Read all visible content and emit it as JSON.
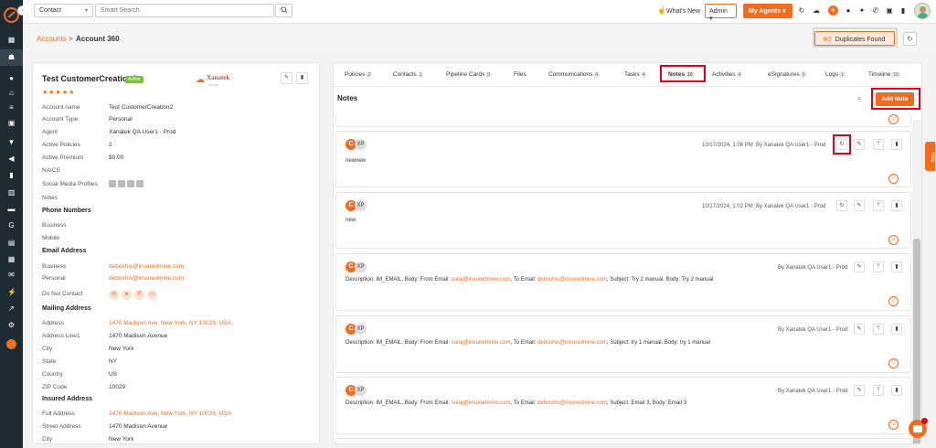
{
  "topbar": {
    "search_type": "Contact",
    "search_placeholder": "Smart Search",
    "whats_new": "What's New",
    "role": "Admin",
    "my_agents": "My Agents"
  },
  "breadcrumb": {
    "parent": "Accounts",
    "separator": ">",
    "current": "Account 360"
  },
  "duplicates": {
    "count": "2",
    "label": "Duplicates Found"
  },
  "account": {
    "name": "Test CustomerCreation2",
    "status": "Active",
    "stars": "★★★★★",
    "logo_name": "Xanatek",
    "logo_sub": "Group",
    "fields": [
      {
        "label": "Account name",
        "value": "Test CustomerCreation2"
      },
      {
        "label": "Account Type",
        "value": "Personal"
      },
      {
        "label": "Agent",
        "value": "Xanatek QA User1 - Prod"
      },
      {
        "label": "Active Policies",
        "value": "2"
      },
      {
        "label": "Active Premium",
        "value": "$0.00"
      },
      {
        "label": "NAICS",
        "value": ""
      },
      {
        "label": "Social Media Profiles",
        "value": ""
      },
      {
        "label": "Notes",
        "value": ""
      }
    ],
    "phone": {
      "title": "Phone Numbers",
      "business_label": "Business",
      "mobile_label": "Mobile"
    },
    "email": {
      "title": "Email Address",
      "business_label": "Business",
      "business_value": "deboshis@insuredmine.com",
      "personal_label": "Personal",
      "personal_value": "deboshis@insuredmine.com",
      "dnc_label": "Do Not Contact"
    },
    "mailing": {
      "title": "Mailing Address",
      "fields": [
        {
          "label": "Address",
          "value": "1470 Madison Ave, New York, NY 10029, USA"
        },
        {
          "label": "Address Line1",
          "value": "1470 Madison Avenue"
        },
        {
          "label": "City",
          "value": "New York"
        },
        {
          "label": "State",
          "value": "NY"
        },
        {
          "label": "Country",
          "value": "US"
        },
        {
          "label": "ZIP Code",
          "value": "10029"
        }
      ]
    },
    "insured": {
      "title": "Insured Address",
      "fields": [
        {
          "label": "Full Address",
          "value": "1470 Madison Ave, New York, NY 10029, USA"
        },
        {
          "label": "Street Address",
          "value": "1470 Madison Avenue"
        },
        {
          "label": "City",
          "value": "New York"
        }
      ]
    }
  },
  "tabs": [
    {
      "label": "Policies",
      "count": "2"
    },
    {
      "label": "Contacts",
      "count": "1"
    },
    {
      "label": "Pipeline Cards",
      "count": "0"
    },
    {
      "label": "Files",
      "count": ""
    },
    {
      "label": "Communications",
      "count": "4"
    },
    {
      "label": "Tasks",
      "count": "4"
    },
    {
      "label": "Notes",
      "count": "10"
    },
    {
      "label": "Activities",
      "count": "4"
    },
    {
      "label": "eSignatures",
      "count": "0"
    },
    {
      "label": "Logs",
      "count": "1"
    },
    {
      "label": "Timeline",
      "count": "10"
    }
  ],
  "notes_panel": {
    "title": "Notes",
    "add_label": "Add Note",
    "initials": "XP",
    "notes": [
      {
        "date": "10/17/2024, 1:06 PM",
        "author": "By Xanatek QA User1 - Prod",
        "text": "newnew",
        "email": null
      },
      {
        "date": "10/17/2024, 1:02 PM",
        "author": "By Xanatek QA User1 - Prod",
        "text": "new",
        "email": null
      },
      {
        "date": "",
        "author": "By Xanatek QA User1 - Prod",
        "email": {
          "prefix": "Description: IM_EMAIL, Body: From Email:",
          "from": "suraj@insuredmine.com",
          "mid": ", To Email:",
          "to": "deboshis@insuredmine.com",
          "suffix": ", Subject: Try 2 manual, Body: Try 2 manual"
        }
      },
      {
        "date": "",
        "author": "By Xanatek QA User1 - Prod",
        "email": {
          "prefix": "Description: IM_EMAIL, Body: From Email:",
          "from": "suraj@insuredmine.com",
          "mid": ", To Email:",
          "to": "deboshis@insuredmine.com",
          "suffix": ", Subject: try 1 manual, Body: try 1 manual"
        }
      },
      {
        "date": "",
        "author": "By Xanatek QA User1 - Prod",
        "email": {
          "prefix": "Description: IM_EMAIL, Body: From Email:",
          "from": "suraj@insuredmine.com",
          "mid": ", To Email:",
          "to": "deboshis@insuredmine.com",
          "suffix": ", Subject: Email 3, Body: Email 3"
        }
      }
    ]
  },
  "help_label": "Help",
  "colors": {
    "accent": "#f26c1f",
    "highlight": "#e0001b",
    "nav_bg": "#1f2b33"
  }
}
